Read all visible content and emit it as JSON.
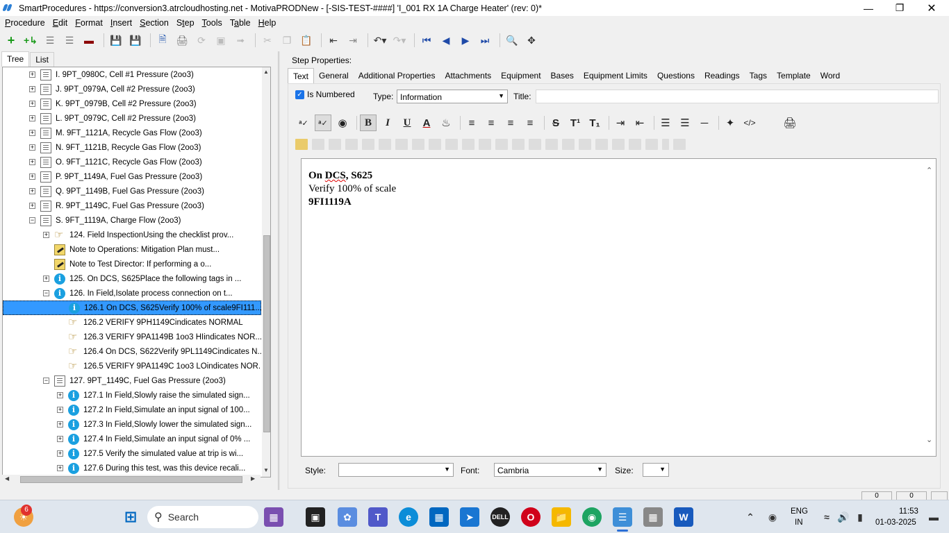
{
  "window": {
    "title": "SmartProcedures - https://conversion3.atrcloudhosting.net - MotivaPRODNew - [-SIS-TEST-####] 'I_001 RX 1A Charge Heater' (rev: 0)*"
  },
  "menu": [
    {
      "pre": "",
      "u": "P",
      "post": "rocedure"
    },
    {
      "pre": "",
      "u": "E",
      "post": "dit"
    },
    {
      "pre": "",
      "u": "F",
      "post": "ormat"
    },
    {
      "pre": "",
      "u": "I",
      "post": "nsert"
    },
    {
      "pre": "",
      "u": "S",
      "post": "ection"
    },
    {
      "pre": "S",
      "u": "t",
      "post": "ep"
    },
    {
      "pre": "",
      "u": "T",
      "post": "ools"
    },
    {
      "pre": "T",
      "u": "a",
      "post": "ble"
    },
    {
      "pre": "",
      "u": "H",
      "post": "elp"
    }
  ],
  "left_tabs": [
    "Tree",
    "List"
  ],
  "tree": [
    {
      "label": "I. 9PT_0980C, Cell #1 Pressure (2oo3)",
      "icon": "doc",
      "exp": "+",
      "level": 0
    },
    {
      "label": "J. 9PT_0979A, Cell #2 Pressure (2oo3)",
      "icon": "doc",
      "exp": "+",
      "level": 0
    },
    {
      "label": "K. 9PT_0979B, Cell #2 Pressure (2oo3)",
      "icon": "doc",
      "exp": "+",
      "level": 0
    },
    {
      "label": "L. 9PT_0979C, Cell #2 Pressure (2oo3)",
      "icon": "doc",
      "exp": "+",
      "level": 0
    },
    {
      "label": "M. 9FT_1121A, Recycle Gas Flow (2oo3)",
      "icon": "doc",
      "exp": "+",
      "level": 0
    },
    {
      "label": "N. 9FT_1121B, Recycle Gas Flow (2oo3)",
      "icon": "doc",
      "exp": "+",
      "level": 0
    },
    {
      "label": "O. 9FT_1121C, Recycle Gas Flow (2oo3)",
      "icon": "doc",
      "exp": "+",
      "level": 0
    },
    {
      "label": "P. 9PT_1149A, Fuel Gas Pressure (2oo3)",
      "icon": "doc",
      "exp": "+",
      "level": 0
    },
    {
      "label": "Q. 9PT_1149B, Fuel Gas Pressure (2oo3)",
      "icon": "doc",
      "exp": "+",
      "level": 0
    },
    {
      "label": "R. 9PT_1149C, Fuel Gas Pressure (2oo3)",
      "icon": "doc",
      "exp": "+",
      "level": 0
    },
    {
      "label": "S. 9FT_1119A, Charge Flow (2oo3)",
      "icon": "doc",
      "exp": "−",
      "level": 0
    },
    {
      "label": "124. Field InspectionUsing the checklist prov...",
      "icon": "hand",
      "exp": "+",
      "level": 1
    },
    {
      "label": "Note to Operations: Mitigation Plan must...",
      "icon": "note",
      "exp": "",
      "level": 1
    },
    {
      "label": "Note to Test Director: If performing a o...",
      "icon": "note",
      "exp": "",
      "level": 1
    },
    {
      "label": "125. On DCS, S625Place the following tags in ...",
      "icon": "info",
      "exp": "+",
      "level": 1
    },
    {
      "label": "126. In Field,Isolate process connection on t...",
      "icon": "info",
      "exp": "−",
      "level": 1
    },
    {
      "label": "126.1 On DCS, S625Verify 100% of scale9FI111...",
      "icon": "info",
      "exp": "",
      "level": 2,
      "selected": true
    },
    {
      "label": "126.2 VERIFY 9PH1149Cindicates NORMAL",
      "icon": "hand",
      "exp": "",
      "level": 2
    },
    {
      "label": "126.3 VERIFY 9PA1149B 1oo3 HIindicates NOR...",
      "icon": "hand",
      "exp": "",
      "level": 2
    },
    {
      "label": "126.4 On DCS, S622Verify 9PL1149Cindicates N...",
      "icon": "hand",
      "exp": "",
      "level": 2
    },
    {
      "label": "126.5 VERIFY 9PA1149C 1oo3 LOindicates NOR...",
      "icon": "hand",
      "exp": "",
      "level": 2
    },
    {
      "label": "127. 9PT_1149C, Fuel Gas Pressure (2oo3)",
      "icon": "doc",
      "exp": "−",
      "level": 1
    },
    {
      "label": "127.1 In Field,Slowly raise the simulated sign...",
      "icon": "info",
      "exp": "+",
      "level": 2
    },
    {
      "label": "127.2 In Field,Simulate an input signal of 100...",
      "icon": "info",
      "exp": "+",
      "level": 2
    },
    {
      "label": "127.3 In Field,Slowly lower the simulated sign...",
      "icon": "info",
      "exp": "+",
      "level": 2
    },
    {
      "label": "127.4 In Field,Simulate an input signal of 0% ...",
      "icon": "info",
      "exp": "+",
      "level": 2
    },
    {
      "label": "127.5 Verify the simulated value at trip is wi...",
      "icon": "info",
      "exp": "+",
      "level": 2
    },
    {
      "label": "127.6 During this test, was this device recali...",
      "icon": "info",
      "exp": "+",
      "level": 2
    }
  ],
  "step_props": {
    "heading": "Step Properties:",
    "tabs": [
      "Text",
      "General",
      "Additional Properties",
      "Attachments",
      "Equipment",
      "Bases",
      "Equipment Limits",
      "Questions",
      "Readings",
      "Tags",
      "Template",
      "Word"
    ],
    "is_numbered_label": "Is Numbered",
    "type_label": "Type:",
    "type_value": "Information",
    "title_label": "Title:",
    "title_value": ""
  },
  "editor": {
    "line1_a": "On ",
    "line1_b": "DCS",
    "line1_c": ", S625",
    "line2": "Verify 100% of scale",
    "line3": "9FI1119A"
  },
  "bottom": {
    "style_label": "Style:",
    "style_value": "",
    "font_label": "Font:",
    "font_value": "Cambria",
    "size_label": "Size:",
    "size_value": ""
  },
  "status": {
    "box1": "0",
    "box2": "0"
  },
  "taskbar": {
    "search_placeholder": "Search",
    "badge_count": "6",
    "lang1": "ENG",
    "lang2": "IN",
    "time": "11:53",
    "date": "01-03-2025"
  },
  "colors": {
    "selection": "#3399ff",
    "accent": "#1a73e8"
  }
}
